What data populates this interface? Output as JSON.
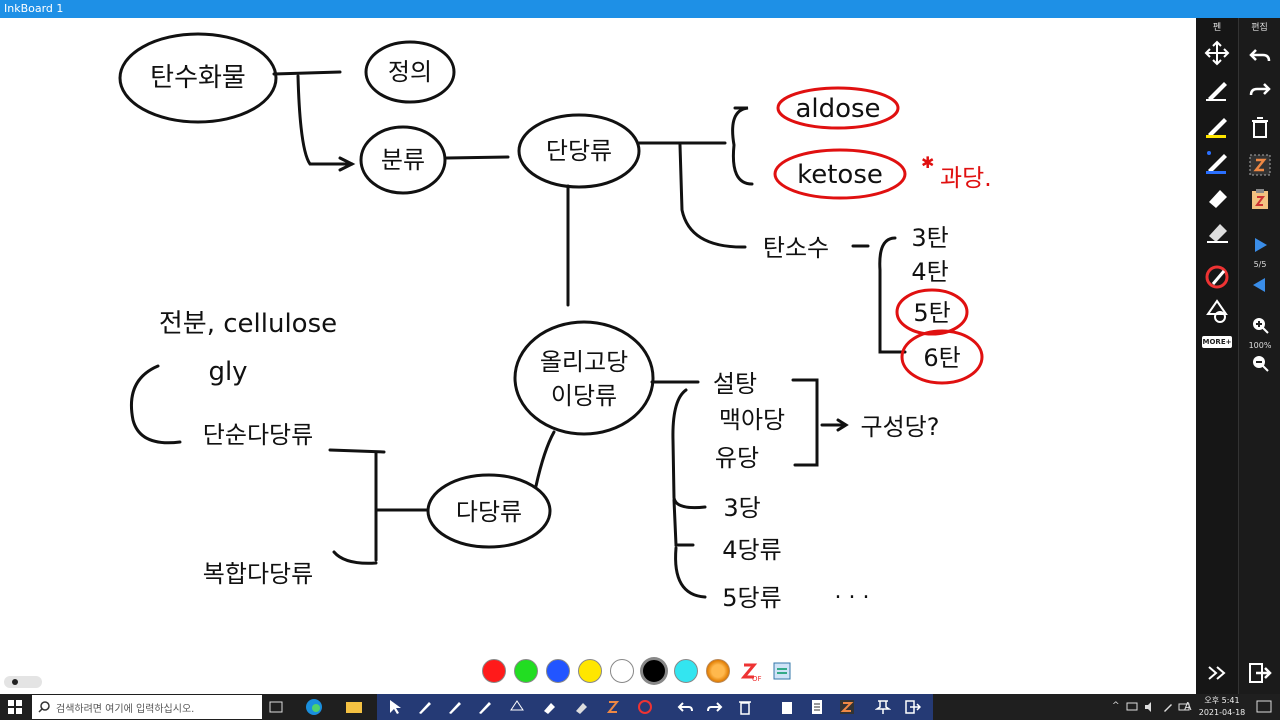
{
  "window": {
    "title": "InkBoard 1"
  },
  "panels": {
    "pen_title": "펜",
    "edit_title": "편집",
    "page_indicator": "5/5",
    "zoom_level": "100%",
    "more_label": "MORE+"
  },
  "board": {
    "nodes": {
      "root": "탄수화물",
      "definition": "정의",
      "classification": "분류",
      "monosaccharide": "단당류",
      "aldose": "aldose",
      "ketose": "ketose",
      "fruit_sugar_note": "과당.",
      "carbon_count": "탄소수",
      "c3": "3탄",
      "c4": "4탄",
      "c5": "5탄",
      "c6": "6탄",
      "oligosaccharide": "올리고당",
      "disaccharide": "이당류",
      "sucrose": "설탕",
      "maltose": "맥아당",
      "lactose": "유당",
      "components_q": "구성당?",
      "trisaccharide": "3당",
      "tetrasaccharide": "4당류",
      "pentasaccharide": "5당류",
      "ellipsis": ". . .",
      "polysaccharide": "다당류",
      "examples": "전분, cellulose",
      "glycogen": "gly",
      "simple_poly": "단순다당류",
      "complex_poly": "복합다당류"
    }
  },
  "colorbar": {
    "colors": [
      "#ff1a1a",
      "#22dd22",
      "#2255ff",
      "#ffe600",
      "#ffffff",
      "#000000",
      "#33e5f0"
    ]
  },
  "taskbar": {
    "search_placeholder": "검색하려면 여기에 입력하십시오.",
    "time": "오후 5:41",
    "date": "2021-04-18",
    "lang": "A"
  },
  "colors": {
    "ink": "#111111",
    "accent_red": "#e01010",
    "titlebar": "#1e90e6"
  }
}
